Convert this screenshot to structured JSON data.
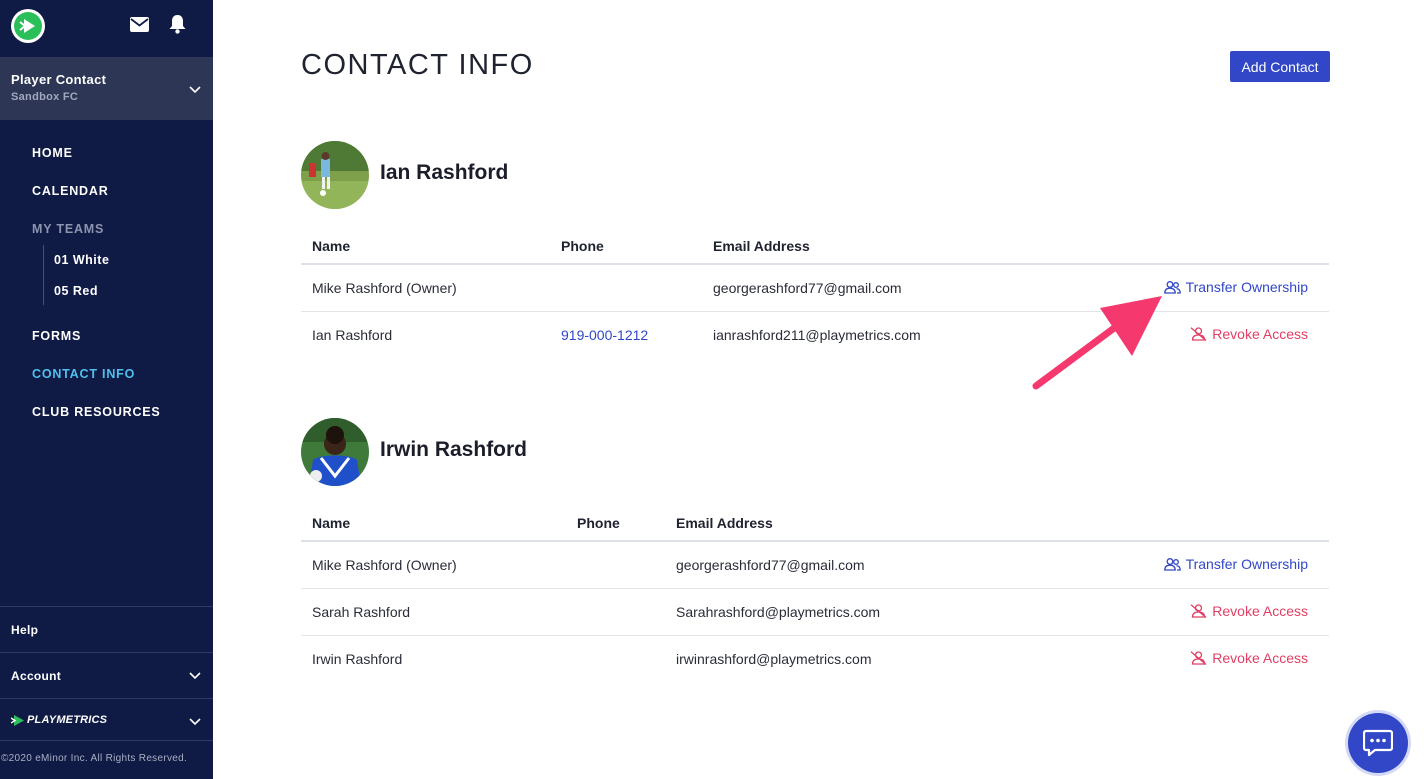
{
  "sidebar": {
    "logo_icon": "playmetrics-logo-icon",
    "top_icons": [
      "mail-icon",
      "bell-icon"
    ],
    "org": {
      "title": "Player Contact",
      "subtitle": "Sandbox FC"
    },
    "nav": {
      "home": "HOME",
      "calendar": "CALENDAR",
      "my_teams": "MY TEAMS",
      "teams": [
        "01 White",
        "05 Red"
      ],
      "forms": "FORMS",
      "contact_info": "CONTACT INFO",
      "club_resources": "CLUB RESOURCES"
    },
    "bottom": {
      "help": "Help",
      "account": "Account",
      "brand": "PLAYMETRICS"
    },
    "copyright": "©2020 eMinor Inc. All Rights Reserved.",
    "active_color": "#4fc0ee",
    "bg_color": "#0f1a45"
  },
  "main": {
    "title": "CONTACT INFO",
    "add_button": "Add Contact",
    "accent": "#3147c8",
    "danger": "#e23e63",
    "headers": {
      "name": "Name",
      "phone": "Phone",
      "email": "Email Address"
    },
    "players": [
      {
        "name": "Ian Rashford",
        "contacts": [
          {
            "name": "Mike Rashford (Owner)",
            "phone": "",
            "email": "georgerashford77@gmail.com",
            "action": "Transfer Ownership"
          },
          {
            "name": "Ian Rashford",
            "phone": "919-000-1212",
            "email": "ianrashford211@playmetrics.com",
            "action": "Revoke Access"
          }
        ]
      },
      {
        "name": "Irwin Rashford",
        "contacts": [
          {
            "name": "Mike Rashford (Owner)",
            "phone": "",
            "email": "georgerashford77@gmail.com",
            "action": "Transfer Ownership"
          },
          {
            "name": "Sarah Rashford",
            "phone": "",
            "email": "Sarahrashford@playmetrics.com",
            "action": "Revoke Access"
          },
          {
            "name": "Irwin Rashford",
            "phone": "",
            "email": "irwinrashford@playmetrics.com",
            "action": "Revoke Access"
          }
        ]
      }
    ]
  },
  "annotation": {
    "arrow_color": "#f5386e"
  },
  "chat_icon": "chat-bubble-icon"
}
